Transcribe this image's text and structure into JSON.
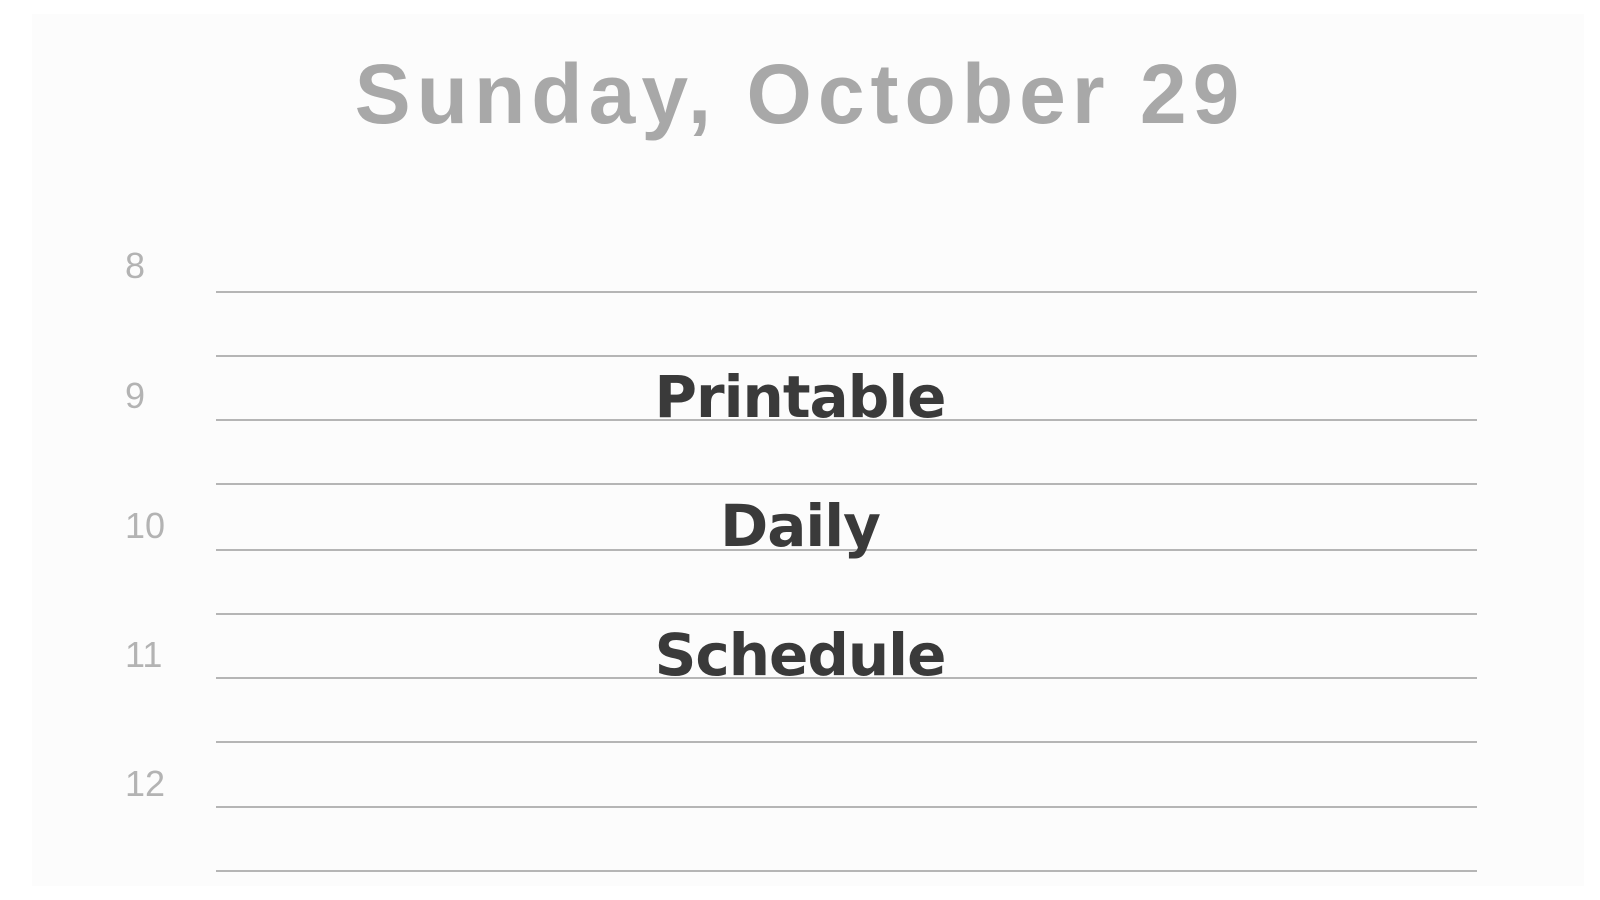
{
  "schedule": {
    "date_heading": "Sunday, October 29",
    "hours": [
      "8",
      "9",
      "10",
      "11",
      "12"
    ],
    "line_count": 10
  },
  "overlay": {
    "words": [
      "Printable",
      "Daily",
      "Schedule"
    ]
  },
  "colors": {
    "page_background": "#fcfcfc",
    "heading_text": "#a8a8a8",
    "hour_text": "#b3b3b3",
    "rule_line": "#b5b5b5",
    "overlay_text": "#3a3a3a"
  }
}
